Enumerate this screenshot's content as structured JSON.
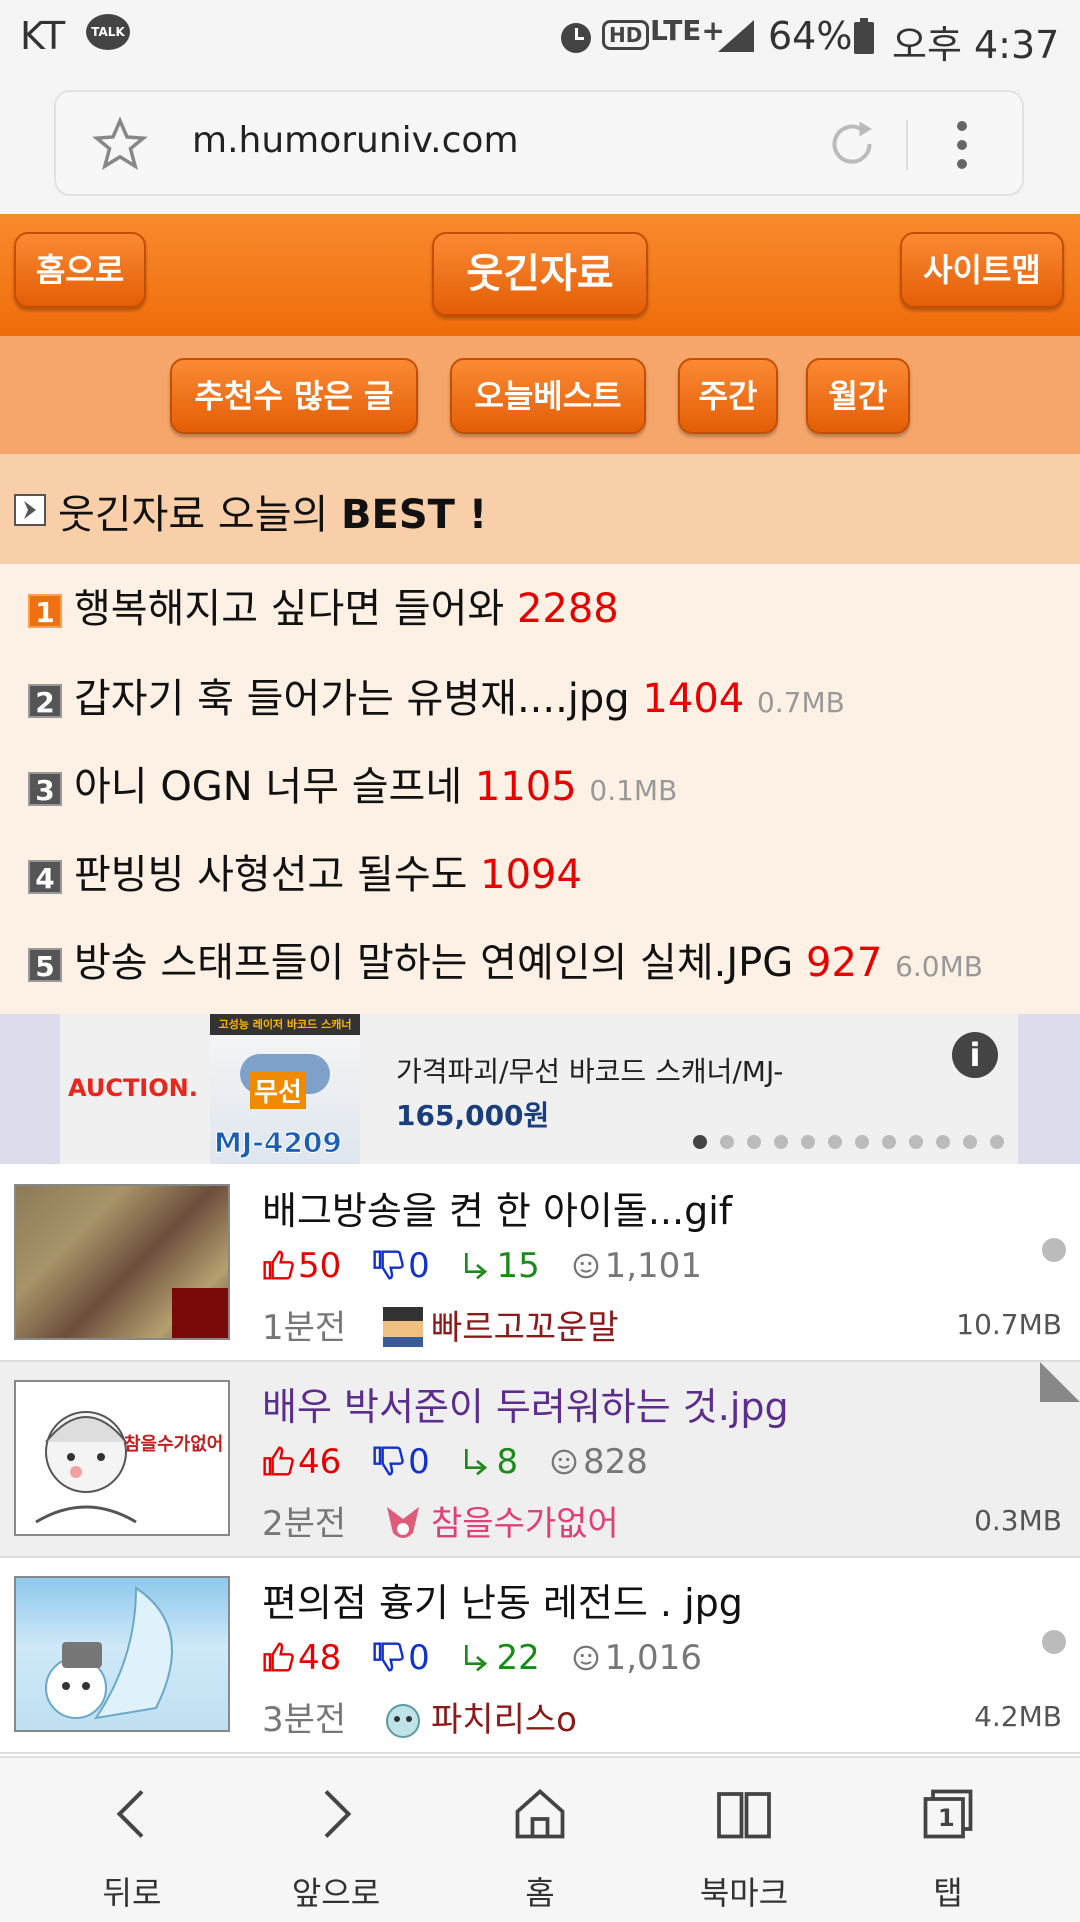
{
  "status": {
    "carrier": "KT",
    "talk": "TALK",
    "hd": "HD",
    "net": "LTE+",
    "battery": "64%",
    "time": "오후 4:37"
  },
  "browser": {
    "url": "m.humoruniv.com"
  },
  "header": {
    "home": "홈으로",
    "title": "웃긴자료",
    "sitemap": "사이트맵"
  },
  "filters": [
    "추천수 많은 글",
    "오늘베스트",
    "주간",
    "월간"
  ],
  "best": {
    "heading_prefix": "웃긴자료 오늘의 ",
    "heading_bold": "BEST !",
    "items": [
      {
        "num": "1",
        "title": "행복해지고 싶다면 들어와",
        "count": "2288",
        "size": ""
      },
      {
        "num": "2",
        "title": "갑자기 훅 들어가는 유병재....jpg",
        "count": "1404",
        "size": "0.7MB"
      },
      {
        "num": "3",
        "title": "아니 OGN 너무 슬프네",
        "count": "1105",
        "size": "0.1MB"
      },
      {
        "num": "4",
        "title": "판빙빙 사형선고 될수도",
        "count": "1094",
        "size": ""
      },
      {
        "num": "5",
        "title": "방송 스태프들이 말하는 연예인의 실체.JPG",
        "count": "927",
        "size": "6.0MB"
      }
    ]
  },
  "ad": {
    "brand": "AUCTION.",
    "tag": "무선",
    "model": "MJ-4209",
    "title": "가격파괴/무선 바코드 스캐너/MJ-",
    "price": "165,000원",
    "info": "i",
    "top_text": "고성능 레이저 바코드 스캐너"
  },
  "posts": [
    {
      "title": "배그방송을 켠 한 아이돌...gif",
      "up": "50",
      "down": "0",
      "reply": "15",
      "views": "1,101",
      "time": "1분전",
      "author": "빠르고꼬운말",
      "size": "10.7MB",
      "visited": false,
      "title_color": "#111",
      "author_color": "#8b1a1a"
    },
    {
      "title": "배우 박서준이 두려워하는 것.jpg",
      "up": "46",
      "down": "0",
      "reply": "8",
      "views": "828",
      "time": "2분전",
      "author": "참을수가없어",
      "size": "0.3MB",
      "visited": true,
      "title_color": "#5b2d8c",
      "author_color": "#e0407a",
      "thumb_text": "참을수가없어"
    },
    {
      "title": "편의점 흉기 난동 레전드 . jpg",
      "up": "48",
      "down": "0",
      "reply": "22",
      "views": "1,016",
      "time": "3분전",
      "author": "파치리스o",
      "size": "4.2MB",
      "visited": false,
      "title_color": "#111",
      "author_color": "#8b1a1a"
    }
  ],
  "nav": [
    {
      "label": "뒤로",
      "icon": "back-icon"
    },
    {
      "label": "앞으로",
      "icon": "forward-icon"
    },
    {
      "label": "홈",
      "icon": "home-icon"
    },
    {
      "label": "북마크",
      "icon": "bookmark-icon"
    },
    {
      "label": "탭",
      "icon": "tabs-icon",
      "count": "1"
    }
  ],
  "colors": {
    "orange": "#ef6c0a",
    "best_bg": "#fdf1e5",
    "red": "#e60000"
  }
}
